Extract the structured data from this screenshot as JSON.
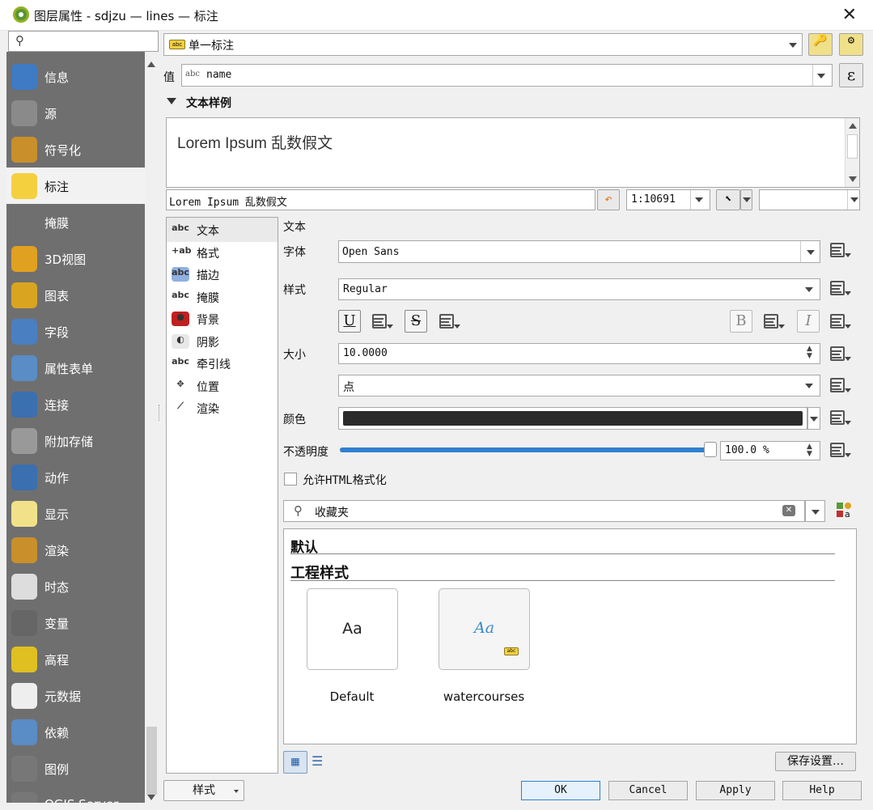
{
  "window": {
    "title": "图层属性 - sdjzu — lines — 标注"
  },
  "sidebar": {
    "search_placeholder": "",
    "items": [
      {
        "label": "信息",
        "icon": "info-icon",
        "color": "#3e7bc4"
      },
      {
        "label": "源",
        "icon": "source-tools-icon",
        "color": "#8a8a8a"
      },
      {
        "label": "符号化",
        "icon": "paintbrush-icon",
        "color": "#c98f2b"
      },
      {
        "label": "标注",
        "icon": "label-abc-icon",
        "color": "#f4d03f"
      },
      {
        "label": "掩膜",
        "icon": "mask-abc-icon",
        "color": "#6f6f6f"
      },
      {
        "label": "3D视图",
        "icon": "cube-3d-icon",
        "color": "#e0a020"
      },
      {
        "label": "图表",
        "icon": "chart-icon",
        "color": "#d9a520"
      },
      {
        "label": "字段",
        "icon": "fields-icon",
        "color": "#4a7fc1"
      },
      {
        "label": "属性表单",
        "icon": "form-icon",
        "color": "#5a8cc5"
      },
      {
        "label": "连接",
        "icon": "join-icon",
        "color": "#3a6fb0"
      },
      {
        "label": "附加存储",
        "icon": "database-icon",
        "color": "#999999"
      },
      {
        "label": "动作",
        "icon": "gear-action-icon",
        "color": "#3a6fb0"
      },
      {
        "label": "显示",
        "icon": "speech-bubble-icon",
        "color": "#f1e28a"
      },
      {
        "label": "渲染",
        "icon": "render-brush-icon",
        "color": "#c98f2b"
      },
      {
        "label": "时态",
        "icon": "clock-icon",
        "color": "#dddddd"
      },
      {
        "label": "变量",
        "icon": "epsilon-icon",
        "color": "#666666"
      },
      {
        "label": "高程",
        "icon": "elevation-icon",
        "color": "#e0c020"
      },
      {
        "label": "元数据",
        "icon": "metadata-icon",
        "color": "#eeeeee"
      },
      {
        "label": "依赖",
        "icon": "dependencies-icon",
        "color": "#5a8cc5"
      },
      {
        "label": "图例",
        "icon": "legend-icon",
        "color": "#777777"
      },
      {
        "label": "QGIS Server",
        "icon": "server-icon",
        "color": "#777777"
      }
    ]
  },
  "labeling": {
    "mode": "单一标注",
    "value_label": "值",
    "value_field": "name",
    "value_type": "abc",
    "sample_header": "文本样例",
    "sample_text": "Lorem Ipsum 乱数假文",
    "sample_input": "Lorem Ipsum 乱数假文",
    "scale": "1:10691"
  },
  "tree": [
    {
      "label": "文本",
      "icon": "text-abc-icon"
    },
    {
      "label": "格式",
      "icon": "format-icon"
    },
    {
      "label": "描边",
      "icon": "buffer-abc-icon"
    },
    {
      "label": "掩膜",
      "icon": "mask-abc-icon"
    },
    {
      "label": "背景",
      "icon": "background-shield-icon"
    },
    {
      "label": "阴影",
      "icon": "shadow-icon"
    },
    {
      "label": "牵引线",
      "icon": "callout-icon"
    },
    {
      "label": "位置",
      "icon": "placement-icon"
    },
    {
      "label": "渲染",
      "icon": "rendering-brush-icon"
    }
  ],
  "text_panel": {
    "section_title": "文本",
    "font_label": "字体",
    "font_value": "Open Sans",
    "style_label": "样式",
    "style_value": "Regular",
    "underline": "U",
    "strike": "S",
    "bold": "B",
    "italic": "I",
    "size_label": "大小",
    "size_value": "10.0000",
    "unit_value": "点",
    "color_label": "颜色",
    "color_value": "#2b2b2b",
    "opacity_label": "不透明度",
    "opacity_value": "100.0 %",
    "opacity_fraction": 1.0,
    "html_label": "允许HTML格式化",
    "favorites_placeholder": "收藏夹",
    "group_default": "默认",
    "group_project": "工程样式",
    "styles": [
      {
        "name": "Default",
        "preview": "Aa"
      },
      {
        "name": "watercourses",
        "preview": "Aa"
      }
    ],
    "save_settings": "保存设置…"
  },
  "footer": {
    "style_menu": "样式",
    "ok": "OK",
    "cancel": "Cancel",
    "apply": "Apply",
    "help": "Help"
  },
  "colors": {
    "sidebar_bg": "#6f6f6f",
    "accent_blue": "#2f7fd0",
    "label_yellow": "#f4d03f"
  }
}
